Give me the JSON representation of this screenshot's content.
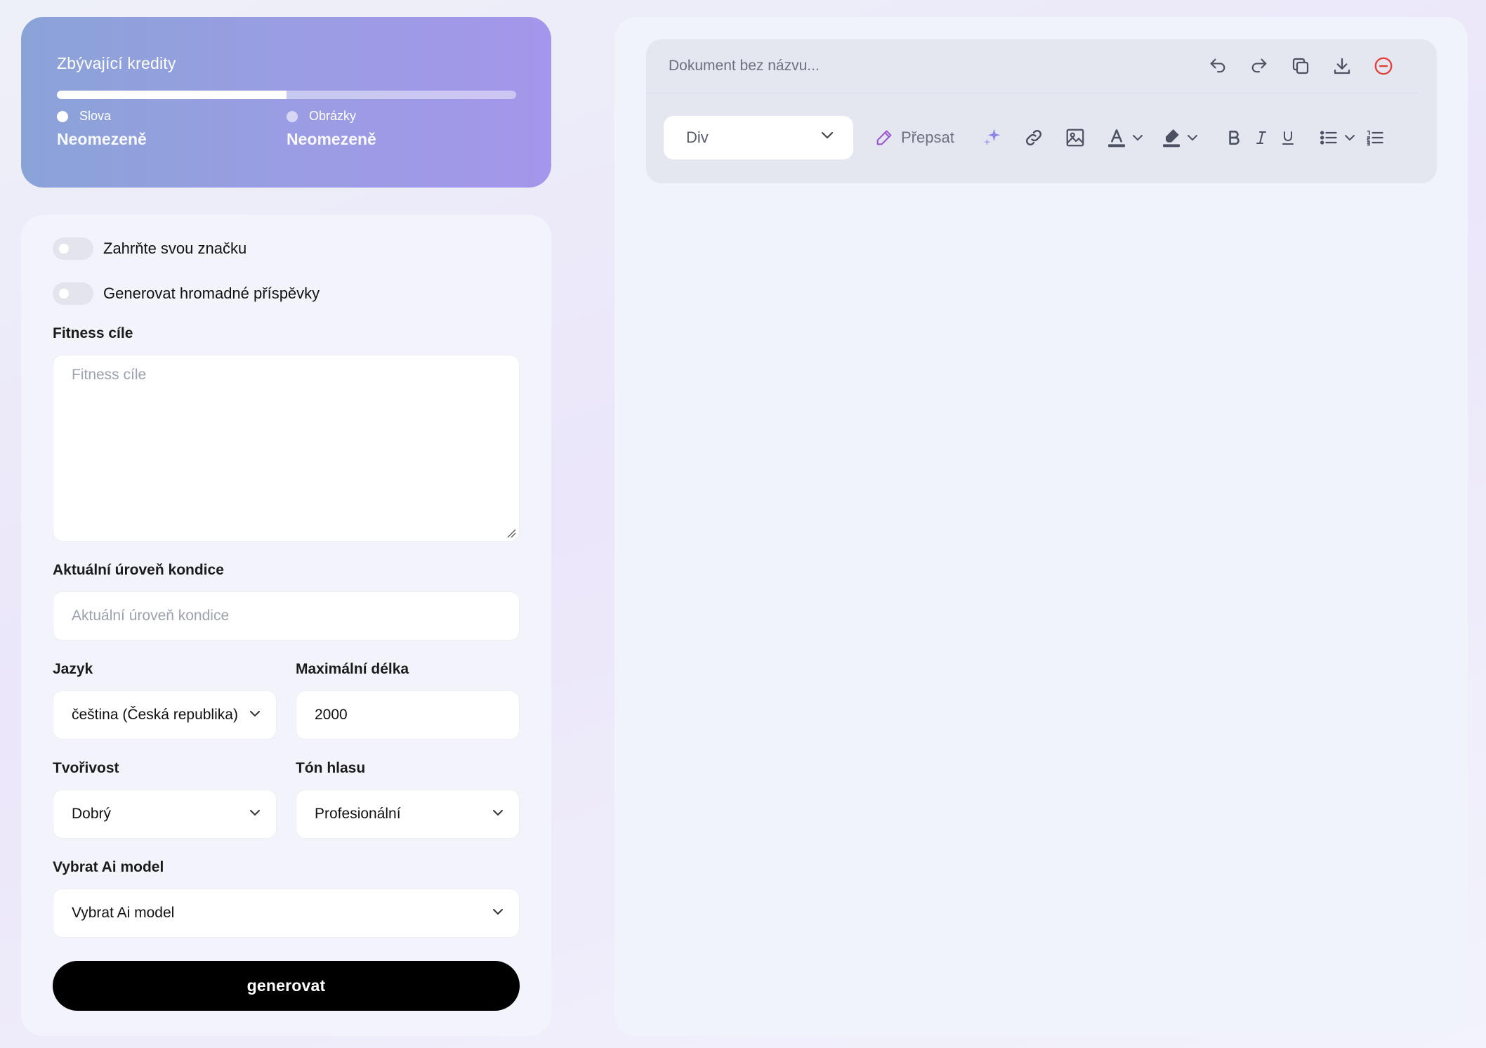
{
  "credits": {
    "title": "Zbývající kredity",
    "progress_words_fraction": 0.5,
    "words": {
      "label": "Slova",
      "value": "Neomezeně",
      "dot_color": "#ffffff"
    },
    "images": {
      "label": "Obrázky",
      "value": "Neomezeně",
      "dot_color": "#d8d6f5"
    }
  },
  "form": {
    "toggle_brand": {
      "label": "Zahrňte svou značku",
      "on": false
    },
    "toggle_bulk": {
      "label": "Generovat hromadné příspěvky",
      "on": false
    },
    "fitness_goals": {
      "label": "Fitness cíle",
      "placeholder": "Fitness cíle",
      "value": ""
    },
    "fitness_level": {
      "label": "Aktuální úroveň kondice",
      "placeholder": "Aktuální úroveň kondice",
      "value": ""
    },
    "language": {
      "label": "Jazyk",
      "value": "čeština (Česká republika)"
    },
    "max_length": {
      "label": "Maximální délka",
      "value": "2000"
    },
    "creativity": {
      "label": "Tvořivost",
      "value": "Dobrý"
    },
    "tone": {
      "label": "Tón hlasu",
      "value": "Profesionální"
    },
    "ai_model": {
      "label": "Vybrat Ai model",
      "value": "Vybrat Ai model"
    },
    "generate_label": "generovat"
  },
  "editor": {
    "doc_title_placeholder": "Dokument bez názvu...",
    "block_type": "Div",
    "rewrite_label": "Přepsat",
    "icons": [
      "undo-icon",
      "redo-icon",
      "copy-icon",
      "download-icon",
      "remove-icon",
      "sparkle-icon",
      "link-icon",
      "image-icon",
      "text-color-icon",
      "highlight-icon",
      "bold-icon",
      "italic-icon",
      "underline-icon",
      "bullet-list-icon",
      "numbered-list-icon"
    ],
    "colors": {
      "accent_purple": "#9b59d0",
      "danger": "#e0413a",
      "sparkle": "#8d87e6"
    }
  }
}
